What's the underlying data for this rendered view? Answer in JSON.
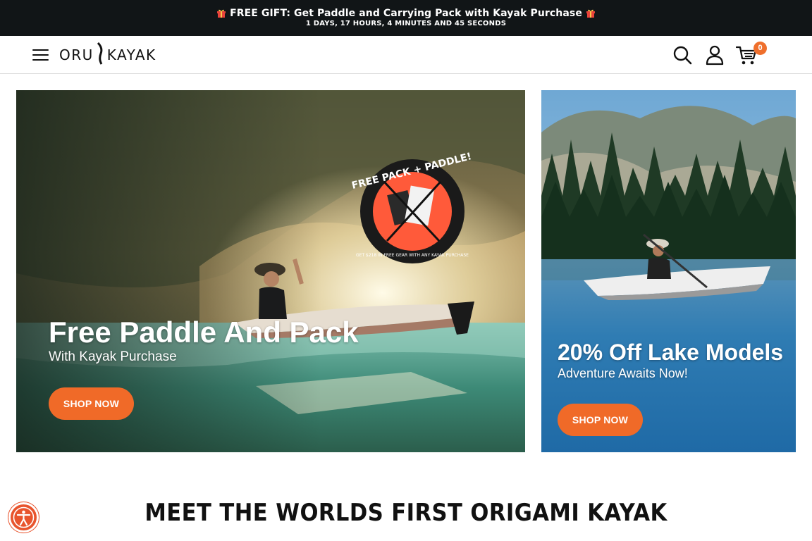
{
  "announcement": {
    "text": "FREE GIFT: Get Paddle and Carrying Pack with Kayak Purchase",
    "countdown": "1 DAYS, 17 HOURS, 4 MINUTES AND 45 SECONDS"
  },
  "header": {
    "logo_left": "ORU",
    "logo_right": "KAYAK",
    "cart_count": "0"
  },
  "banners": [
    {
      "title": "Free Paddle And Pack",
      "subtitle": "With Kayak Purchase",
      "button": "SHOP NOW",
      "badge_top": "FREE PACK + PADDLE!",
      "badge_bottom": "GET $218 IN FREE GEAR WITH ANY KAYAK PURCHASE"
    },
    {
      "title": "20% Off Lake Models",
      "subtitle": "Adventure Awaits Now!",
      "button": "SHOP NOW"
    }
  ],
  "section": {
    "title": "MEET THE WORLDS FIRST ORIGAMI KAYAK"
  },
  "icons": [
    "gift-icon",
    "menu-icon",
    "search-icon",
    "account-icon",
    "cart-icon",
    "accessibility-icon"
  ],
  "colors": {
    "accent": "#f06a28",
    "promo_bar": "#111517"
  }
}
